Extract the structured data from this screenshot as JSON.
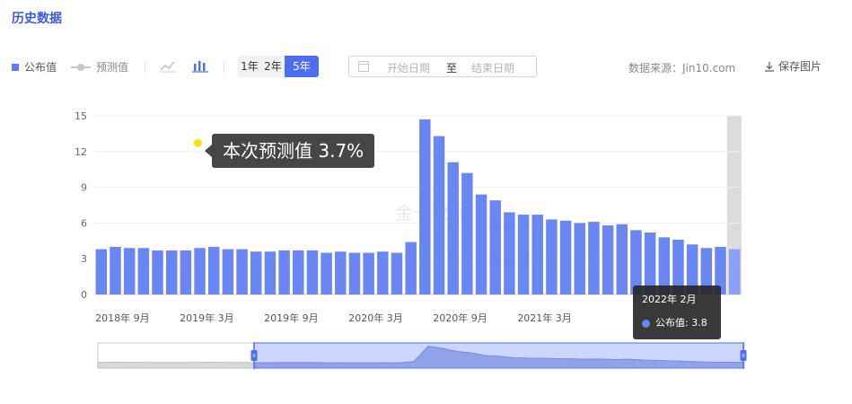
{
  "header": {
    "title": "历史数据"
  },
  "toolbar": {
    "legend_published": "公布值",
    "legend_forecast": "预测值",
    "ranges": [
      "1年",
      "2年",
      "5年"
    ],
    "active_range": "5年",
    "date_start_placeholder": "开始日期",
    "date_to": "至",
    "date_end_placeholder": "结束日期",
    "source": "数据来源：Jin10.com",
    "save_label": "保存图片"
  },
  "colors": {
    "bar": "#6a86f3",
    "bar_last": "#8ca1f5",
    "accent": "#4d6ef0",
    "forecast_dot": "#ffe000"
  },
  "forecast": {
    "text": "本次预测值 3.7%"
  },
  "tooltip": {
    "date": "2022年 2月",
    "series": "公布值",
    "value": "3.8"
  },
  "watermark": "金十数据",
  "chart_data": {
    "type": "bar",
    "series": [
      {
        "name": "公布值"
      }
    ],
    "values": [
      3.8,
      4.0,
      3.9,
      3.9,
      3.7,
      3.7,
      3.7,
      3.9,
      4.0,
      3.8,
      3.8,
      3.6,
      3.6,
      3.7,
      3.7,
      3.7,
      3.5,
      3.6,
      3.5,
      3.5,
      3.6,
      3.5,
      4.4,
      14.7,
      13.3,
      11.1,
      10.2,
      8.4,
      7.9,
      6.9,
      6.7,
      6.7,
      6.3,
      6.2,
      6.0,
      6.1,
      5.8,
      5.9,
      5.4,
      5.2,
      4.8,
      4.6,
      4.2,
      3.9,
      4.0,
      3.8
    ],
    "xticks": [
      "2018年 9月",
      "2019年 3月",
      "2019年 9月",
      "2020年 3月",
      "2020年 9月",
      "2021年 3月"
    ],
    "xtick_bar_index": [
      1.5,
      7.5,
      13.5,
      19.5,
      25.5,
      31.5
    ],
    "yticks": [
      0,
      3,
      6,
      9,
      12,
      15
    ],
    "ylim": [
      0,
      15
    ],
    "grid": true,
    "highlight_index": 45
  }
}
